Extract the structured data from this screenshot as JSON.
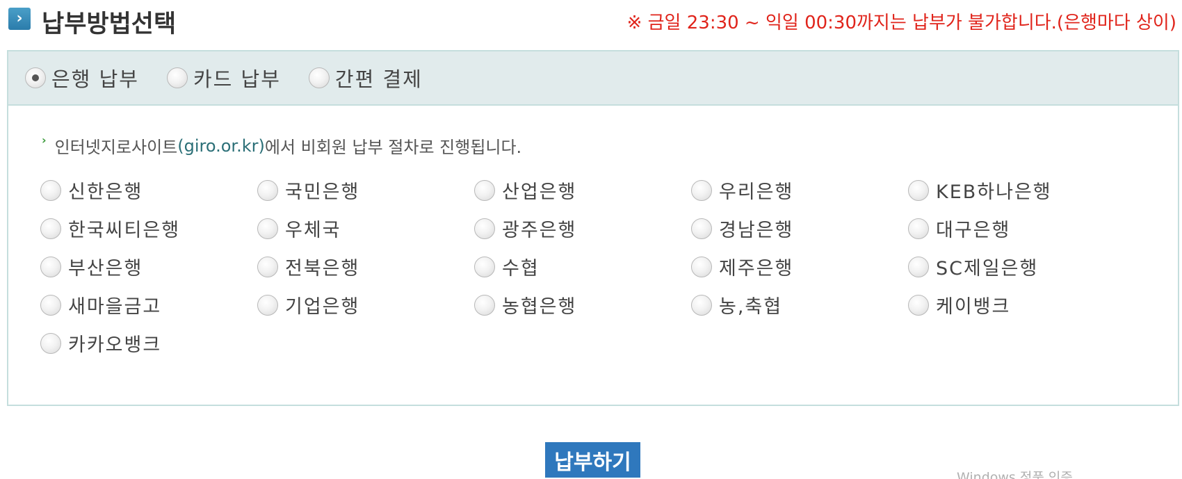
{
  "header": {
    "title": "납부방법선택",
    "icon": "chevron-right-icon",
    "notice": "※ 금일 23:30 ~ 익일 00:30까지는 납부가 불가합니다.(은행마다 상이)"
  },
  "tabs": [
    {
      "label": "은행 납부",
      "selected": true
    },
    {
      "label": "카드 납부",
      "selected": false
    },
    {
      "label": "간편 결제",
      "selected": false
    }
  ],
  "info": {
    "prefix": "인터넷지로사이트",
    "link": "(giro.or.kr)",
    "suffix": "에서 비회원 납부 절차로 진행됩니다."
  },
  "banks": [
    "신한은행",
    "국민은행",
    "산업은행",
    "우리은행",
    "KEB하나은행",
    "한국씨티은행",
    "우체국",
    "광주은행",
    "경남은행",
    "대구은행",
    "부산은행",
    "전북은행",
    "수협",
    "제주은행",
    "SC제일은행",
    "새마을금고",
    "기업은행",
    "농협은행",
    "농,축협",
    "케이뱅크",
    "카카오뱅크"
  ],
  "pay_button": "납부하기",
  "watermark": "Windows 정품 인증",
  "colors": {
    "accent": "#2f78bd",
    "notice": "#e0241b",
    "tab_bg": "#e1ebec",
    "border": "#c5dedd"
  }
}
